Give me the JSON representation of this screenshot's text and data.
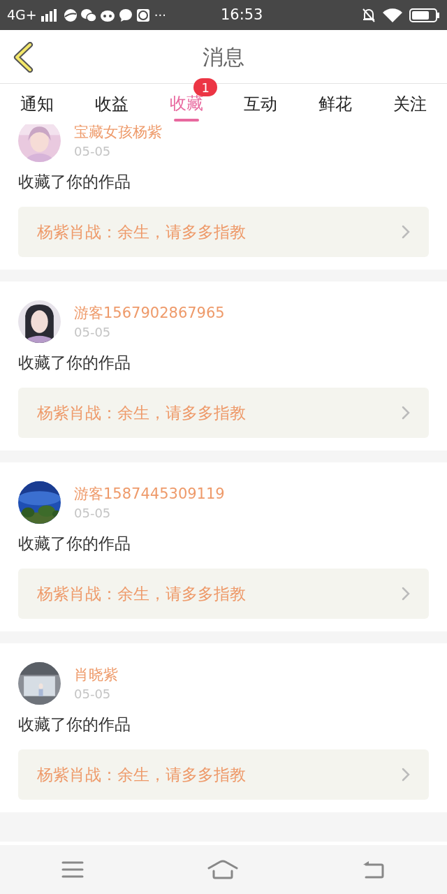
{
  "status_bar": {
    "network": "4G+",
    "more": "···",
    "time": "16:53"
  },
  "header": {
    "title": "消息"
  },
  "tabs": [
    {
      "label": "通知",
      "selected": false
    },
    {
      "label": "收益",
      "selected": false
    },
    {
      "label": "收藏",
      "selected": true,
      "badge": "1"
    },
    {
      "label": "互动",
      "selected": false
    },
    {
      "label": "鲜花",
      "selected": false
    },
    {
      "label": "关注",
      "selected": false
    }
  ],
  "messages": [
    {
      "user": "宝藏女孩杨紫",
      "date": "05-05",
      "action": "收藏了你的作品",
      "work": "杨紫肖战：余生，请多多指教"
    },
    {
      "user": "游客1567902867965",
      "date": "05-05",
      "action": "收藏了你的作品",
      "work": "杨紫肖战：余生，请多多指教"
    },
    {
      "user": "游客1587445309119",
      "date": "05-05",
      "action": "收藏了你的作品",
      "work": "杨紫肖战：余生，请多多指教"
    },
    {
      "user": "肖晓紫",
      "date": "05-05",
      "action": "收藏了你的作品",
      "work": "杨紫肖战：余生，请多多指教"
    }
  ]
}
